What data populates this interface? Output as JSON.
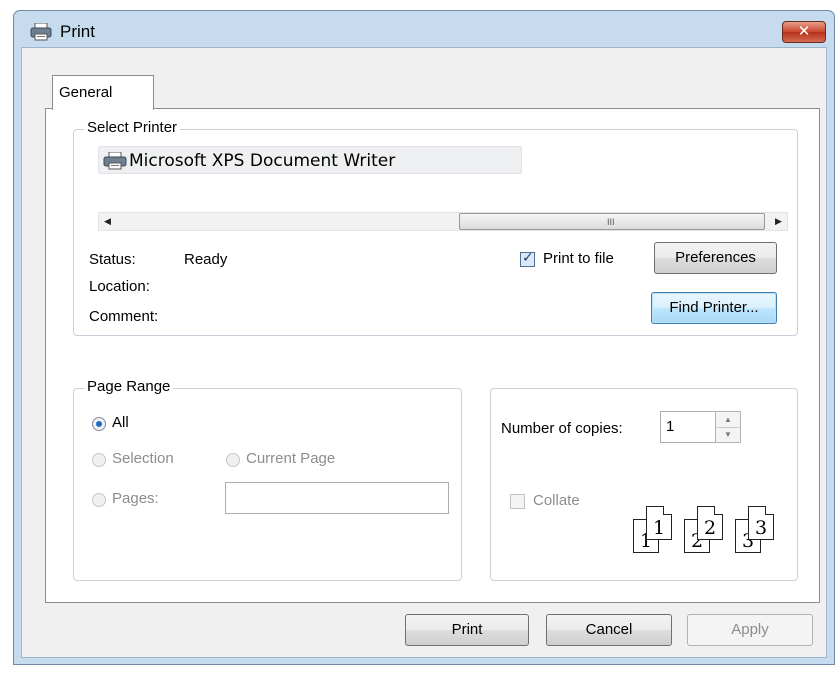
{
  "window": {
    "title": "Print",
    "close_glyph": "✕",
    "icon": "printer-icon"
  },
  "tabs": [
    {
      "label": "General",
      "selected": true
    }
  ],
  "select_printer": {
    "group_label": "Select Printer",
    "printers": [
      {
        "name": "Microsoft XPS Document Writer",
        "icon": "printer-icon"
      }
    ],
    "scrollbar": {
      "left_arrow": "◀",
      "right_arrow": "▶",
      "grip": "III"
    },
    "status_label": "Status:",
    "status_value": "Ready",
    "location_label": "Location:",
    "location_value": "",
    "comment_label": "Comment:",
    "comment_value": "",
    "print_to_file": {
      "label": "Print to file",
      "checked": true
    },
    "preferences_button": "Preferences",
    "find_printer_button": "Find Printer..."
  },
  "page_range": {
    "group_label": "Page Range",
    "options": {
      "all": {
        "label": "All",
        "selected": true
      },
      "selection": {
        "label": "Selection",
        "enabled": false
      },
      "current_page": {
        "label": "Current Page",
        "enabled": false
      },
      "pages": {
        "label": "Pages:",
        "enabled": false,
        "value": ""
      }
    }
  },
  "copies": {
    "label": "Number of copies:",
    "value": "1",
    "up_glyph": "▲",
    "down_glyph": "▼",
    "collate": {
      "label": "Collate",
      "checked": false,
      "enabled": false
    },
    "collate_pages": [
      "1",
      "1",
      "2",
      "2",
      "3",
      "3"
    ]
  },
  "footer": {
    "print_button": "Print",
    "cancel_button": "Cancel",
    "apply_button": "Apply"
  }
}
